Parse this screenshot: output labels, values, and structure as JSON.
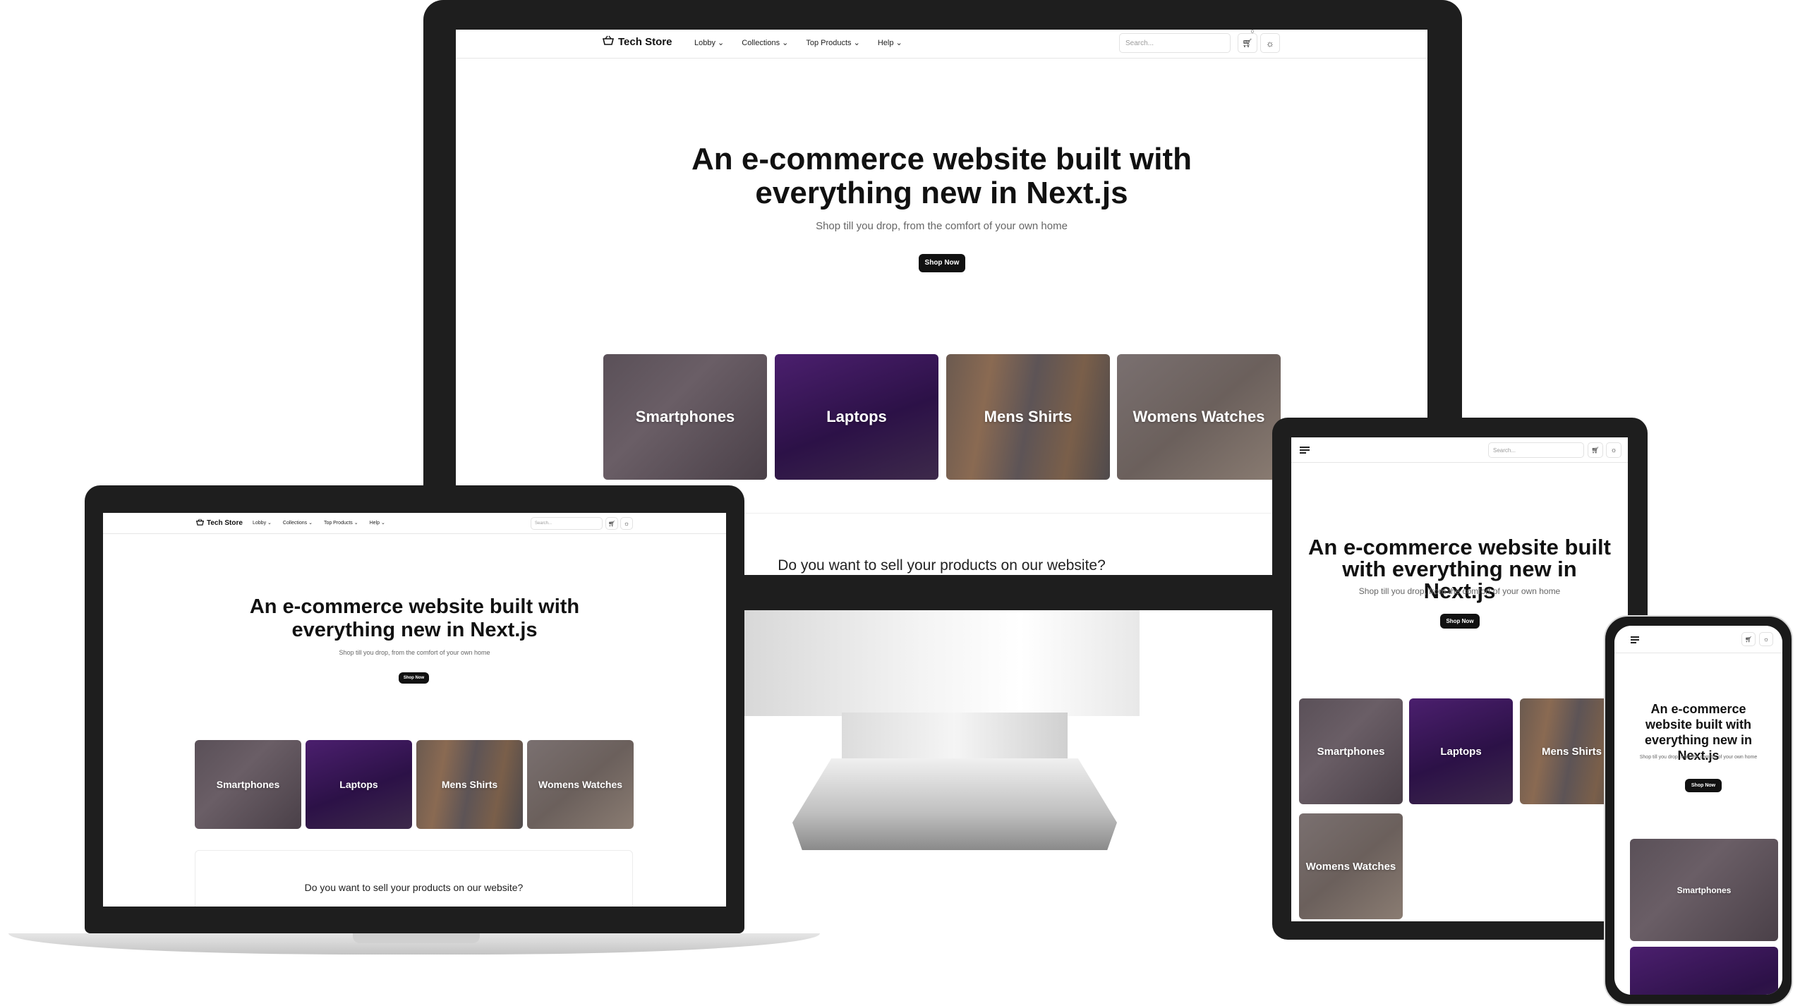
{
  "site": {
    "brand": "Tech Store",
    "nav": [
      "Lobby",
      "Collections",
      "Top Products",
      "Help"
    ],
    "search_placeholder": "Search...",
    "cart_count": "0",
    "hero_title": "An e-commerce website built with everything new in Next.js",
    "hero_subtitle": "Shop till you drop, from the comfort of your own home",
    "cta_label": "Shop Now",
    "categories": [
      "Smartphones",
      "Laptops",
      "Mens Shirts",
      "Womens Watches"
    ],
    "sell_prompt": "Do you want to sell your products on our website?"
  },
  "icons": {
    "brand": "basket-icon",
    "cart": "cart-icon",
    "theme": "sun-icon",
    "menu": "hamburger-menu-icon",
    "dropdown": "chevron-down-icon"
  },
  "colors": {
    "device_frame": "#1e1e1e",
    "primary_button": "#111111",
    "page_background": "#ffffff"
  }
}
